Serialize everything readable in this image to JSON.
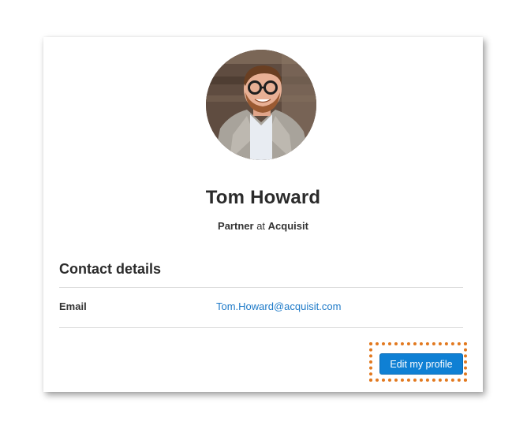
{
  "profile": {
    "name": "Tom Howard",
    "role": "Partner",
    "connector": "at",
    "company": "Acquisit"
  },
  "contact": {
    "section_title": "Contact details",
    "rows": [
      {
        "label": "Email",
        "value": "Tom.Howard@acquisit.com"
      }
    ]
  },
  "actions": {
    "edit_label": "Edit my profile"
  },
  "colors": {
    "link": "#1e7ac8",
    "button": "#0f80d4",
    "focus_ring": "#e2791f"
  }
}
